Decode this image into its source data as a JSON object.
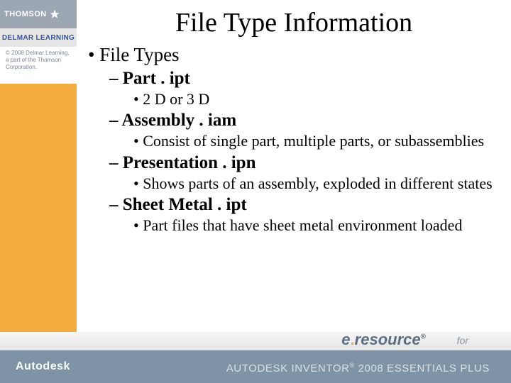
{
  "brand": {
    "thomson": "THOMSON",
    "delmar": "DELMAR LEARNING",
    "copyright": "© 2008 Delmar Learning, a part of the Thomson Corporation."
  },
  "footer": {
    "autodesk": "Autodesk",
    "eresource_e": "e",
    "eresource_dot": ".",
    "eresource_rest": "resource",
    "reg": "®",
    "for": "for",
    "inventor": "AUTODESK INVENTOR",
    "inventor_suffix": " 2008 ESSENTIALS PLUS"
  },
  "slide": {
    "title": "File Type Information",
    "heading": "File Types",
    "items": [
      {
        "label": "Part . ipt",
        "sub": [
          "2 D or 3 D"
        ]
      },
      {
        "label": "Assembly . iam",
        "sub": [
          "Consist of single part, multiple parts, or subassemblies"
        ]
      },
      {
        "label": "Presentation . ipn",
        "sub": [
          "Shows parts of an assembly, exploded in different states"
        ]
      },
      {
        "label": "Sheet Metal . ipt",
        "sub": [
          "Part files that have sheet metal environment loaded"
        ]
      }
    ]
  }
}
